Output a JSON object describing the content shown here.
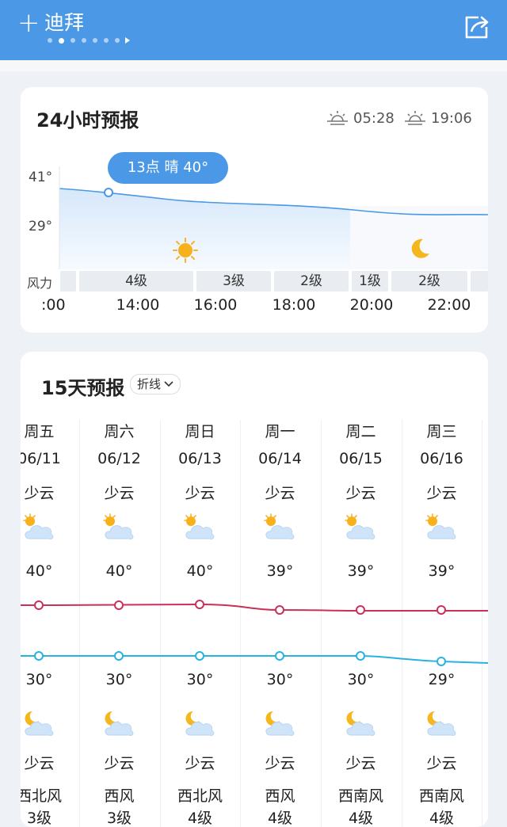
{
  "header": {
    "add_icon": "plus-icon",
    "city": "迪拜",
    "share_icon": "share-icon",
    "bg_color": "#4a98e6"
  },
  "hourly": {
    "title": "24小时预报",
    "sunrise": "05:28",
    "sunset": "19:06",
    "tooltip": "13点 晴 40°",
    "y_ticks": [
      "41°",
      "29°"
    ],
    "wind_label": "风力",
    "wind_segments": [
      "4级",
      "3级",
      "2级",
      "1级",
      "2级"
    ],
    "time_labels": [
      ":00",
      "14:00",
      "16:00",
      "18:00",
      "20:00",
      "22:00"
    ]
  },
  "daily": {
    "title": "15天预报",
    "mode_label": "折线",
    "days": [
      {
        "weekday": "周五",
        "date": "06/11",
        "day_weather": "少云",
        "high": "40°",
        "low": "30°",
        "night_weather": "少云",
        "wind_dir": "西北风",
        "wind_level": "3级"
      },
      {
        "weekday": "周六",
        "date": "06/12",
        "day_weather": "少云",
        "high": "40°",
        "low": "30°",
        "night_weather": "少云",
        "wind_dir": "西风",
        "wind_level": "3级"
      },
      {
        "weekday": "周日",
        "date": "06/13",
        "day_weather": "少云",
        "high": "40°",
        "low": "30°",
        "night_weather": "少云",
        "wind_dir": "西北风",
        "wind_level": "4级"
      },
      {
        "weekday": "周一",
        "date": "06/14",
        "day_weather": "少云",
        "high": "39°",
        "low": "30°",
        "night_weather": "少云",
        "wind_dir": "西风",
        "wind_level": "4级"
      },
      {
        "weekday": "周二",
        "date": "06/15",
        "day_weather": "少云",
        "high": "39°",
        "low": "30°",
        "night_weather": "少云",
        "wind_dir": "西南风",
        "wind_level": "4级"
      },
      {
        "weekday": "周三",
        "date": "06/16",
        "day_weather": "少云",
        "high": "39°",
        "low": "29°",
        "night_weather": "少云",
        "wind_dir": "西南风",
        "wind_level": "4级"
      }
    ],
    "high_color": "#c9305a",
    "low_color": "#27b3e0"
  }
}
